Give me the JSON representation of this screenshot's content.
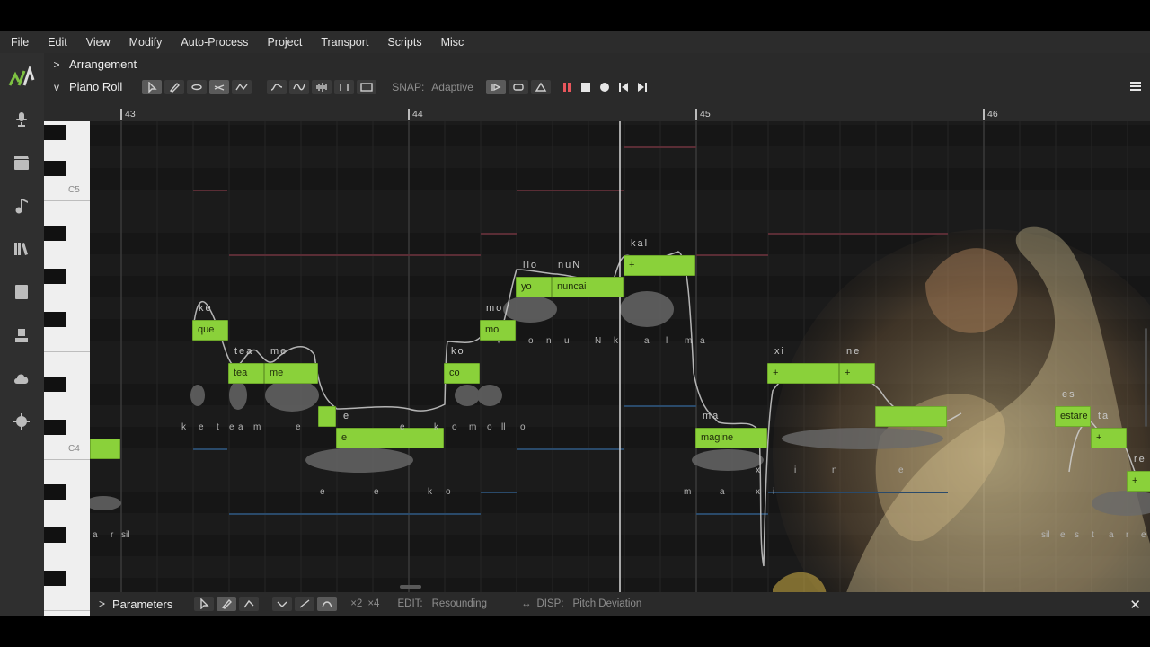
{
  "menu": [
    "File",
    "Edit",
    "View",
    "Modify",
    "Auto-Process",
    "Project",
    "Transport",
    "Scripts",
    "Misc"
  ],
  "arrangement": {
    "label": "Arrangement"
  },
  "piano_roll": {
    "label": "Piano Roll",
    "snap_label": "SNAP:",
    "snap_value": "Adaptive"
  },
  "ruler": {
    "bars": [
      "43",
      "44",
      "45",
      "46"
    ]
  },
  "keyboard": {
    "labels": [
      "C5",
      "C4"
    ]
  },
  "notes": [
    {
      "text": "",
      "lyric": ""
    },
    {
      "text": "que",
      "lyric": "ke"
    },
    {
      "text": "tea",
      "lyric": "tea"
    },
    {
      "text": "me",
      "lyric": "me"
    },
    {
      "text": "",
      "lyric": ""
    },
    {
      "text": "e",
      "lyric": "e"
    },
    {
      "text": "co",
      "lyric": "ko"
    },
    {
      "text": "mo",
      "lyric": "mo"
    },
    {
      "text": "yo",
      "lyric": "llo"
    },
    {
      "text": "nuncai",
      "lyric": "nuN"
    },
    {
      "text": "+",
      "lyric": "kal"
    },
    {
      "text": "magine",
      "lyric": "ma"
    },
    {
      "text": "+",
      "lyric": "xi"
    },
    {
      "text": "+",
      "lyric": "ne"
    },
    {
      "text": "",
      "lyric": ""
    },
    {
      "text": "estare",
      "lyric": "es"
    },
    {
      "text": "+",
      "lyric": "ta"
    },
    {
      "text": "+",
      "lyric": "re"
    }
  ],
  "phonemes": {
    "row1": [
      "k",
      "e",
      "t",
      "e",
      "a",
      "m",
      "e",
      "e",
      "k",
      "o",
      "m",
      "o",
      "ll",
      "o"
    ],
    "row2": [
      "o",
      "n",
      "u",
      "N",
      "k",
      "a",
      "l",
      "m",
      "a"
    ],
    "row3": [
      "e",
      "e",
      "k",
      "o"
    ],
    "row4": [
      "a",
      "r",
      "sil"
    ],
    "row5": [
      "m",
      "a",
      "x",
      "i"
    ],
    "row6": [
      "x",
      "i",
      "n",
      "e"
    ],
    "row7": [
      "sil",
      "e",
      "s",
      "t",
      "a",
      "r",
      "e"
    ]
  },
  "parameters": {
    "label": "Parameters",
    "x2": "×2",
    "x4": "×4",
    "edit_label": "EDIT:",
    "edit_value": "Resounding",
    "disp_label": "DISP:",
    "disp_value": "Pitch Deviation"
  },
  "icons": {
    "sidebar": [
      "microphone-icon",
      "clapperboard-icon",
      "music-note-icon",
      "library-icon",
      "book-icon",
      "export-icon",
      "cloud-check-icon",
      "settings-icon"
    ]
  },
  "colors": {
    "note_green": "#8ad13a",
    "background": "#1b1b1b",
    "playhead": "#d8d8d8"
  }
}
